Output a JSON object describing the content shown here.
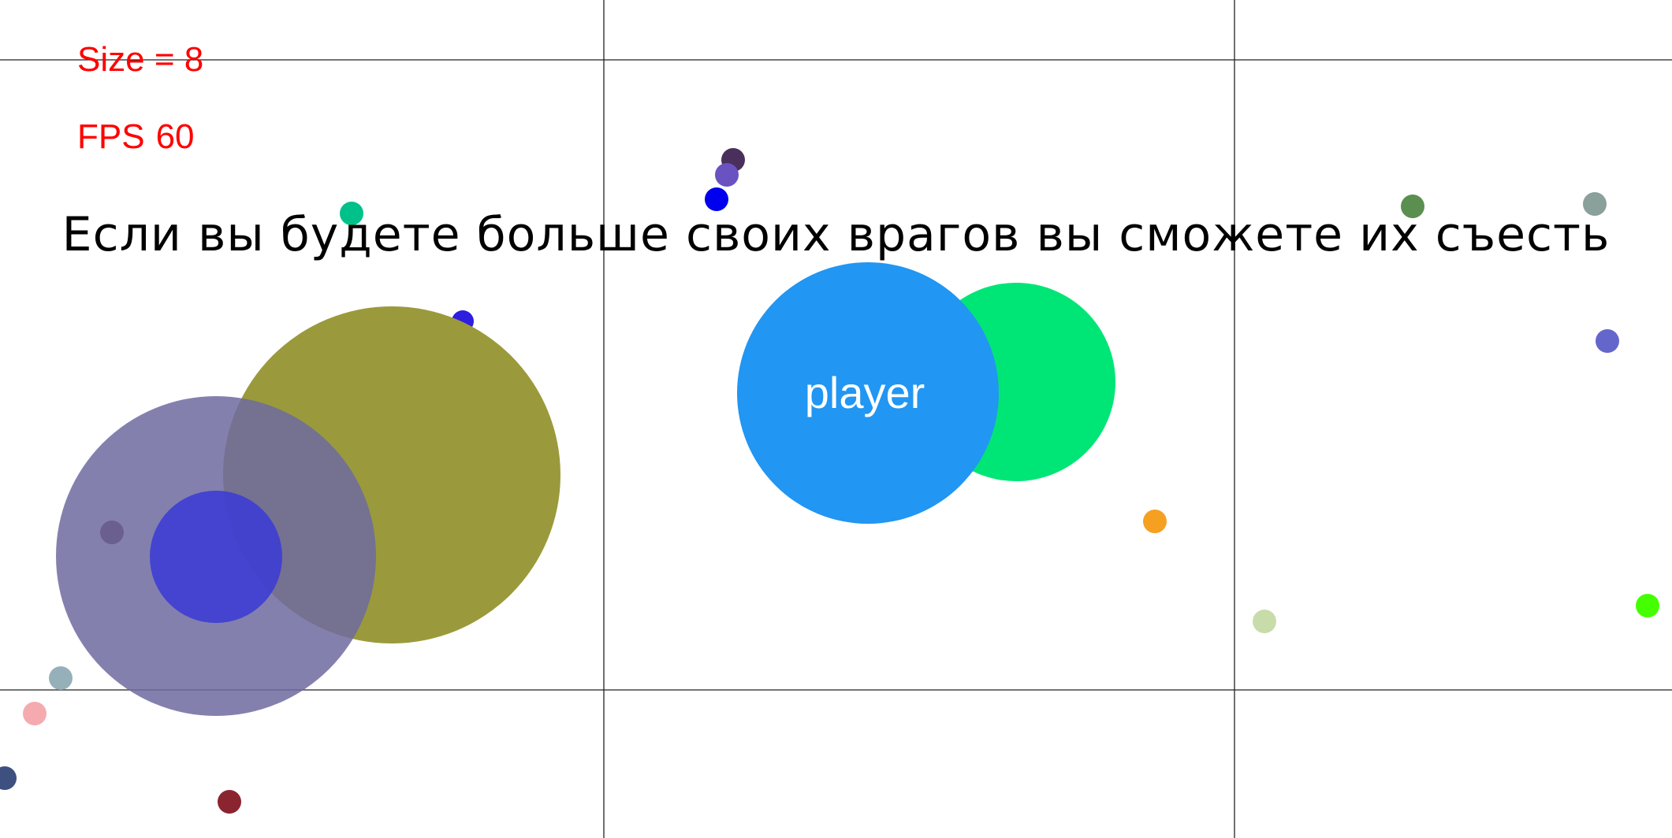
{
  "hud": {
    "size_label": "Size = 8",
    "fps_label": "FPS",
    "fps_value": "60",
    "color": "#ff0000"
  },
  "hint": "Если вы будете больше своих врагов вы сможете их съесть",
  "player": {
    "name": "player",
    "color": "#2196f3"
  },
  "enemy_colors": [
    "#00e676",
    "#9a9a3c",
    "#6f6aa0",
    "#3a3ad6"
  ],
  "food_colors": [
    "#4a2f5c",
    "#6a52c0",
    "#0000ee",
    "#00c18a",
    "#2d1ee0",
    "#5a8f50",
    "#8aa09a",
    "#6566cc",
    "#f5a020",
    "#c8dcaa",
    "#44ff00",
    "#5a2535",
    "#96b0ba",
    "#f5aab0",
    "#3e5080",
    "#8a2530"
  ]
}
